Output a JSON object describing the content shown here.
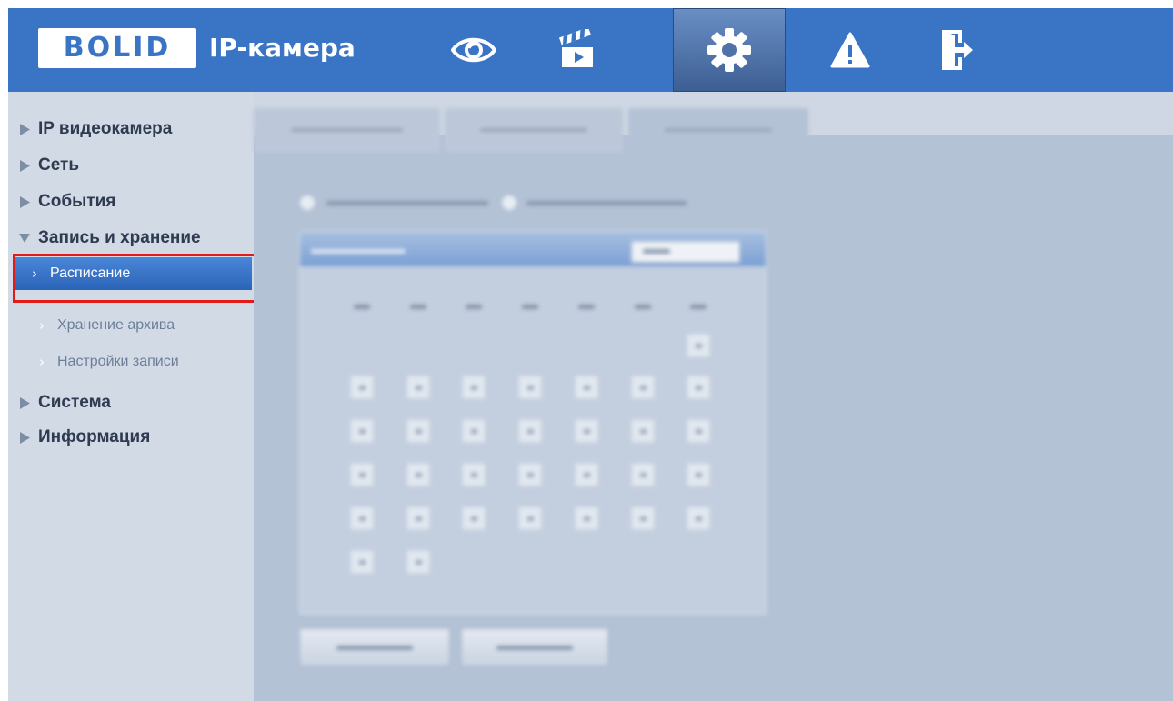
{
  "header": {
    "logo_text": "BOLID",
    "app_title": "IP-камера",
    "nav_icons": [
      "eye-icon",
      "clapperboard-icon",
      "gear-icon",
      "warning-icon",
      "exit-door-icon"
    ],
    "active_nav": "gear-icon",
    "header_color": "#3a74c4"
  },
  "sidebar": {
    "items": [
      {
        "label": "IP видеокамера",
        "expanded": false
      },
      {
        "label": "Сеть",
        "expanded": false
      },
      {
        "label": "События",
        "expanded": false
      },
      {
        "label": "Запись и хранение",
        "expanded": true,
        "children": [
          {
            "label": "Расписание",
            "active": true
          },
          {
            "label": "Хранение архива",
            "active": false
          },
          {
            "label": "Настройки записи",
            "active": false
          }
        ]
      },
      {
        "label": "Система",
        "expanded": false
      },
      {
        "label": "Информация",
        "expanded": false
      }
    ]
  },
  "colors": {
    "highlight_border": "#e11a1a",
    "active_item": "#2f6cc0",
    "content_bg": "#b4c2d6"
  }
}
